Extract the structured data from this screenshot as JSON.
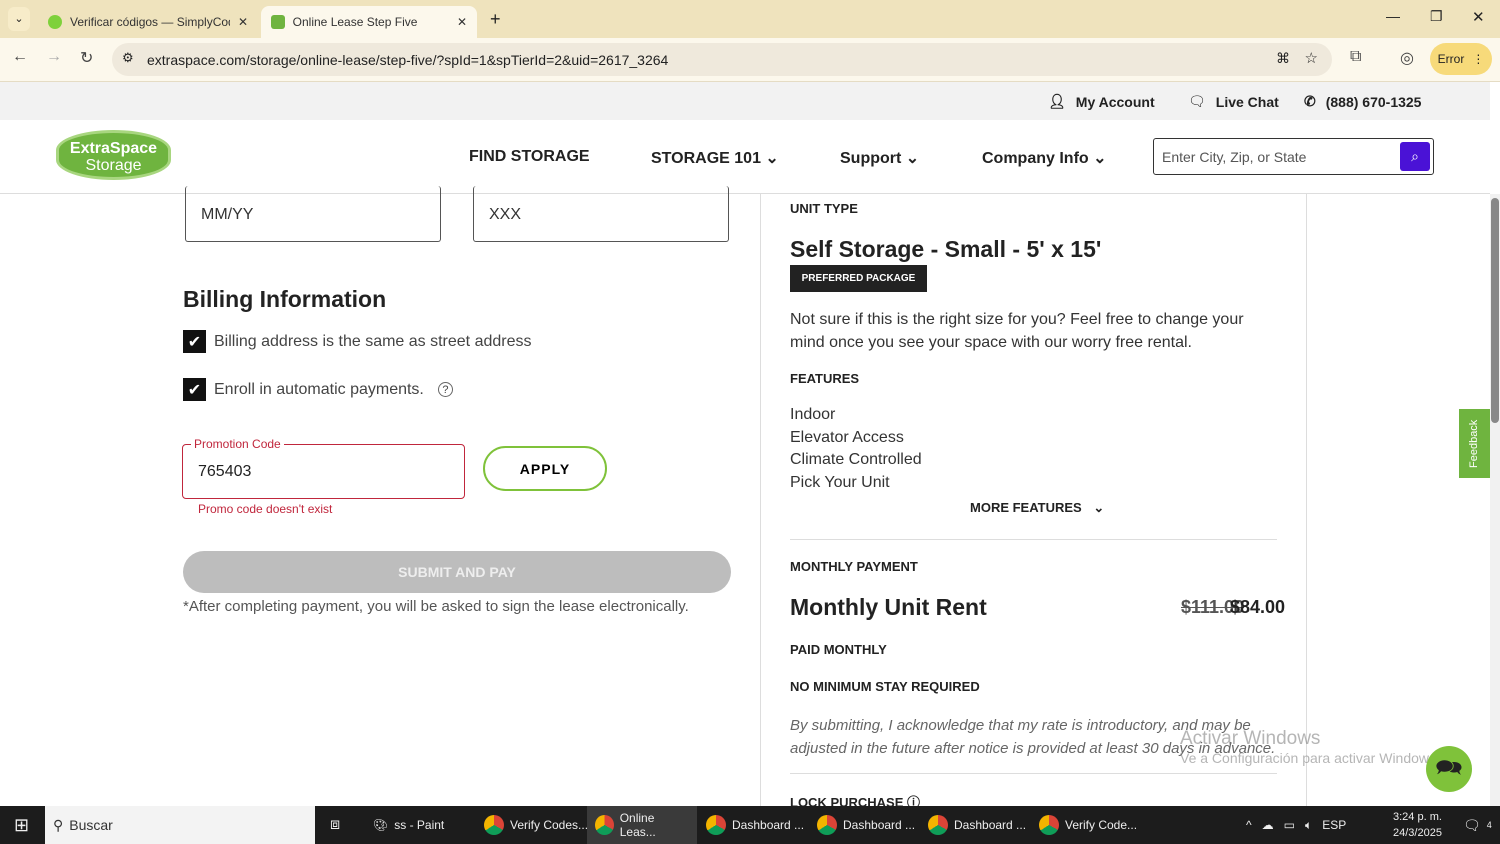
{
  "browser": {
    "tabs": [
      {
        "title": "Verificar códigos — SimplyCode"
      },
      {
        "title": "Online Lease Step Five"
      }
    ],
    "url": "extraspace.com/storage/online-lease/step-five/?spId=1&spTierId=2&uid=2617_3264",
    "profile_label": "Error"
  },
  "util": {
    "account": "My Account",
    "chat": "Live Chat",
    "phone": "(888) 670-1325"
  },
  "header": {
    "logo": "ExtraSpace Storage",
    "logo_line1": "ExtraSpace",
    "logo_line2": "Storage",
    "nav": [
      "FIND STORAGE",
      "STORAGE 101",
      "Support",
      "Company Info"
    ],
    "search_placeholder": "Enter City, Zip, or State"
  },
  "payment": {
    "expiry_placeholder": "MM/YY",
    "cvv_placeholder": "XXX",
    "billing_title": "Billing Information",
    "billing_same": "Billing address is the same as street address",
    "autopay": "Enroll in automatic payments.",
    "promo_label": "Promotion Code",
    "promo_value": "765403",
    "promo_error": "Promo code doesn't exist",
    "apply": "APPLY",
    "submit": "SUBMIT AND PAY",
    "note": "*After completing payment, you will be asked to sign the lease electronically."
  },
  "summary": {
    "unit_type_label": "UNIT TYPE",
    "unit_title": "Self Storage - Small - 5' x 15'",
    "badge": "PREFERRED PACKAGE",
    "size_note": "Not sure if this is the right size for you? Feel free to change your mind once you see your space with our worry free rental.",
    "features_label": "FEATURES",
    "features": [
      "Indoor",
      "Elevator Access",
      "Climate Controlled",
      "Pick Your Unit"
    ],
    "more_features": "MORE FEATURES",
    "monthly_label": "MONTHLY PAYMENT",
    "rent_label": "Monthly Unit Rent",
    "old_price": "$111.00",
    "price": "$84.00",
    "paid_monthly": "PAID MONTHLY",
    "no_min": "NO MINIMUM STAY REQUIRED",
    "disclaimer": "By submitting, I acknowledge that my rate is introductory, and may be adjusted in the future after notice is provided at least 30 days in advance.",
    "lock": "LOCK PURCHASE"
  },
  "feedback": "Feedback",
  "watermark": {
    "line1": "Activar Windows",
    "line2": "Ve a Configuración para activar Windows."
  },
  "taskbar": {
    "search": "Buscar",
    "apps": [
      "ss - Paint",
      "Verify Codes...",
      "Online Leas...",
      "Dashboard ...",
      "Dashboard ...",
      "Dashboard ...",
      "Verify Code..."
    ],
    "lang": "ESP",
    "time": "3:24 p. m.",
    "date": "24/3/2025",
    "notif_count": "4"
  }
}
